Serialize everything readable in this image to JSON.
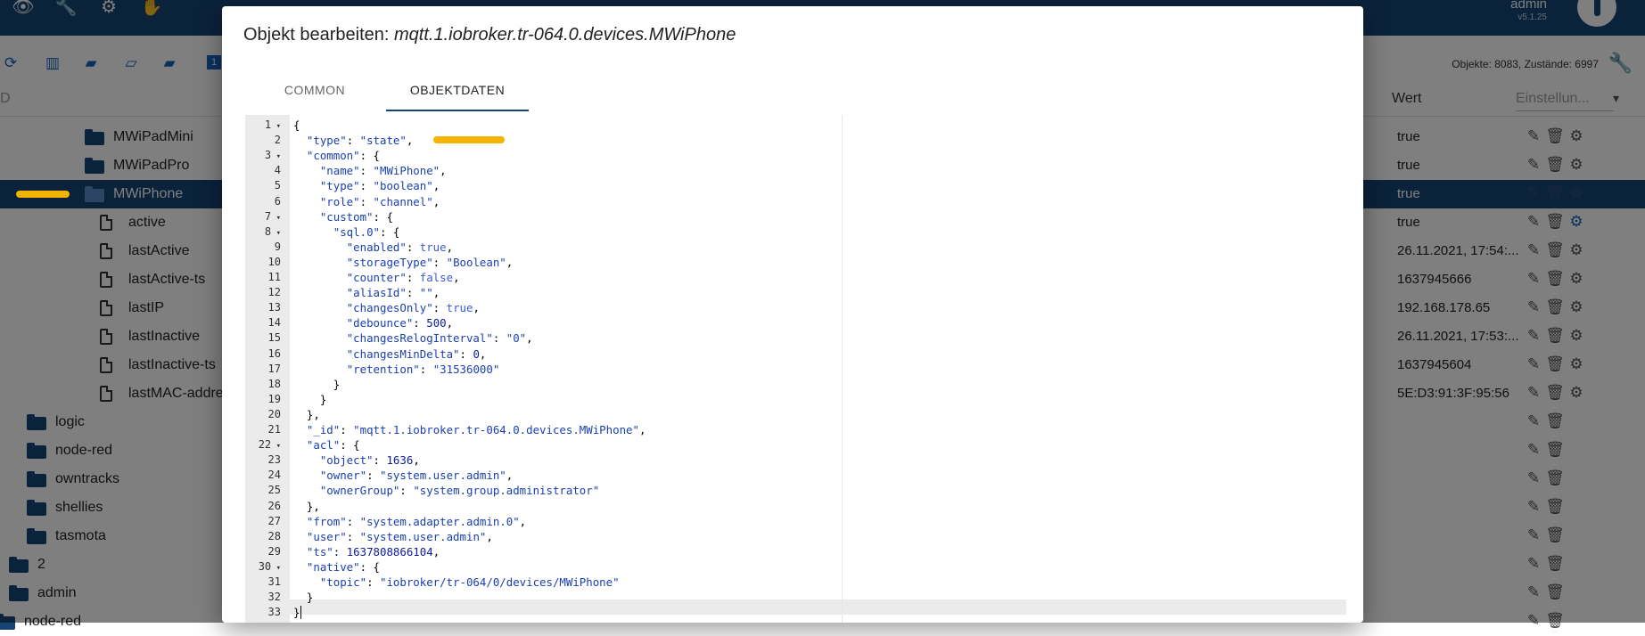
{
  "topbar": {
    "icons": [
      "eye-icon",
      "wrench-icon",
      "brain-icon",
      "hand-icon"
    ],
    "user": "admin",
    "version": "v5.1.25"
  },
  "toolbar": {
    "icons": [
      "refresh-icon",
      "columns-icon",
      "folder-icon",
      "folder-open-icon",
      "folder-icon"
    ],
    "badge": "1",
    "stats": "Objekte: 8083, Zustände: 6997"
  },
  "columns": {
    "id_partial": "D",
    "wert": "Wert",
    "einstellungen": "Einstellun..."
  },
  "tree": [
    {
      "name": "MWiPadMini",
      "icon": "folder",
      "value": "true"
    },
    {
      "name": "MWiPadPro",
      "icon": "folder",
      "value": "true"
    },
    {
      "name": "MWiPhone",
      "icon": "folder-open",
      "value": "true"
    },
    {
      "name": "active",
      "icon": "file",
      "value": "true"
    },
    {
      "name": "lastActive",
      "icon": "file",
      "value": "26.11.2021, 17:54:..."
    },
    {
      "name": "lastActive-ts",
      "icon": "file",
      "value": "1637945666"
    },
    {
      "name": "lastIP",
      "icon": "file",
      "value": "192.168.178.65"
    },
    {
      "name": "lastInactive",
      "icon": "file",
      "value": "26.11.2021, 17:53:..."
    },
    {
      "name": "lastInactive-ts",
      "icon": "file",
      "value": "1637945604"
    },
    {
      "name": "lastMAC-address",
      "icon": "file",
      "value": "5E:D3:91:3F:95:56"
    },
    {
      "name": "logic",
      "icon": "folder",
      "value": ""
    },
    {
      "name": "node-red",
      "icon": "folder",
      "value": ""
    },
    {
      "name": "owntracks",
      "icon": "folder",
      "value": ""
    },
    {
      "name": "shellies",
      "icon": "folder",
      "value": ""
    },
    {
      "name": "tasmota",
      "icon": "folder",
      "value": ""
    },
    {
      "name": "2",
      "icon": "folder",
      "value": ""
    },
    {
      "name": "admin",
      "icon": "folder",
      "value": ""
    },
    {
      "name": "node-red",
      "icon": "folder",
      "value": ""
    }
  ],
  "dialog": {
    "title_prefix": "Objekt bearbeiten: ",
    "title_object": "mqtt.1.iobroker.tr-064.0.devices.MWiPhone",
    "tabs": [
      "COMMON",
      "OBJEKTDATEN"
    ],
    "active_tab": "OBJEKTDATEN",
    "code_lines": [
      "{",
      "  \"type\": \"state\",",
      "  \"common\": {",
      "    \"name\": \"MWiPhone\",",
      "    \"type\": \"boolean\",",
      "    \"role\": \"channel\",",
      "    \"custom\": {",
      "      \"sql.0\": {",
      "        \"enabled\": true,",
      "        \"storageType\": \"Boolean\",",
      "        \"counter\": false,",
      "        \"aliasId\": \"\",",
      "        \"changesOnly\": true,",
      "        \"debounce\": 500,",
      "        \"changesRelogInterval\": \"0\",",
      "        \"changesMinDelta\": 0,",
      "        \"retention\": \"31536000\"",
      "      }",
      "    }",
      "  },",
      "  \"_id\": \"mqtt.1.iobroker.tr-064.0.devices.MWiPhone\",",
      "  \"acl\": {",
      "    \"object\": 1636,",
      "    \"owner\": \"system.user.admin\",",
      "    \"ownerGroup\": \"system.group.administrator\"",
      "  },",
      "  \"from\": \"system.adapter.admin.0\",",
      "  \"user\": \"system.user.admin\",",
      "  \"ts\": 1637808866104,",
      "  \"native\": {",
      "    \"topic\": \"iobroker/tr-064/0/devices/MWiPhone\"",
      "  }",
      "}"
    ],
    "fold_lines": [
      1,
      3,
      7,
      8,
      22,
      30
    ],
    "active_line": 33
  },
  "colors": {
    "brand": "#164477",
    "highlight": "#f5b400",
    "overlay": "rgba(0,0,0,0.5)"
  }
}
